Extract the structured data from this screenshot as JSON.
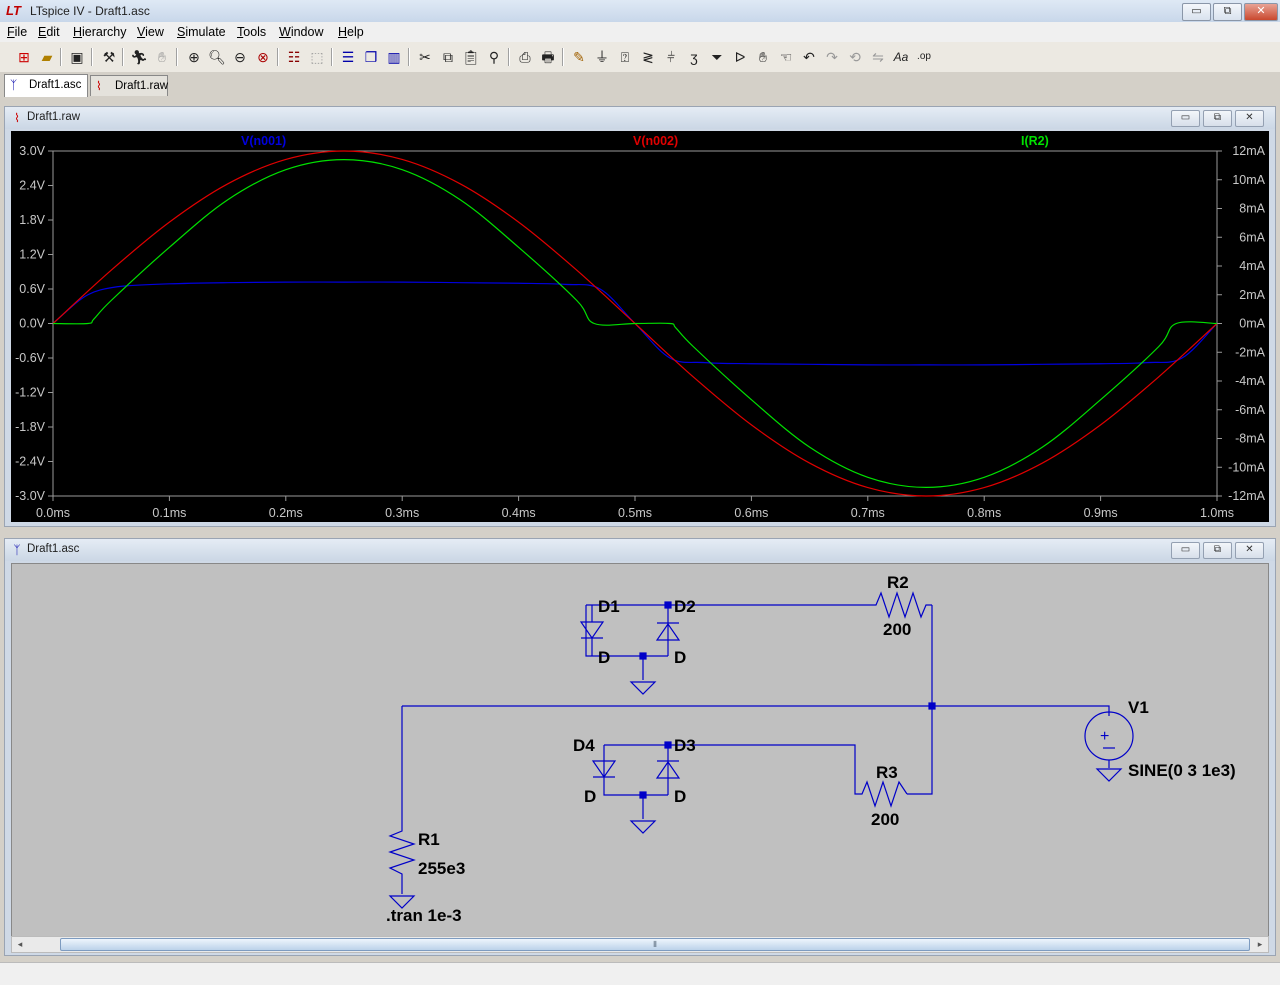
{
  "app": {
    "title": "LTspice IV - Draft1.asc",
    "logo": "LT"
  },
  "window_controls": {
    "minimize": "▭",
    "maximize": "⧉",
    "close": "✕"
  },
  "menu": [
    {
      "label": "File",
      "u": "F",
      "rest": "ile"
    },
    {
      "label": "Edit",
      "u": "E",
      "rest": "dit"
    },
    {
      "label": "Hierarchy",
      "u": "H",
      "rest": "ierarchy"
    },
    {
      "label": "View",
      "u": "V",
      "rest": "iew"
    },
    {
      "label": "Simulate",
      "u": "S",
      "rest": "imulate"
    },
    {
      "label": "Tools",
      "u": "T",
      "rest": "ools"
    },
    {
      "label": "Window",
      "u": "W",
      "rest": "indow"
    },
    {
      "label": "Help",
      "u": "H",
      "rest": "elp"
    }
  ],
  "toolbar_icons": [
    "new-schematic-icon",
    "open-icon",
    "save-icon",
    "control-panel-icon",
    "run-icon",
    "halt-icon",
    "zoom-in-icon",
    "zoom-area-icon",
    "zoom-out-icon",
    "zoom-cancel-icon",
    "autorange-icon",
    "fit-icon",
    "tile-horizontal-icon",
    "cascade-icon",
    "tile-vertical-icon",
    "cut-icon",
    "copy-icon",
    "paste-icon",
    "find-icon",
    "print-setup-icon",
    "print-icon",
    "wire-icon",
    "ground-icon",
    "label-icon",
    "resistor-icon",
    "capacitor-icon",
    "inductor-icon",
    "diode-icon",
    "component-icon",
    "move-icon",
    "drag-icon",
    "undo-icon",
    "redo-icon",
    "rotate-icon",
    "mirror-icon",
    "text-icon",
    "spice-directive-icon"
  ],
  "tabs": [
    {
      "label": "Draft1.asc",
      "active": true
    },
    {
      "label": "Draft1.raw",
      "active": false
    }
  ],
  "plot_window": {
    "title": "Draft1.raw"
  },
  "schematic_window": {
    "title": "Draft1.asc"
  },
  "chart_data": {
    "type": "line",
    "xlabel": "",
    "ylabel": "",
    "xlim": [
      0,
      1.0
    ],
    "ylim_left": [
      -3.0,
      3.0
    ],
    "ylim_right": [
      -12,
      12
    ],
    "x_ticks": [
      "0.0ms",
      "0.1ms",
      "0.2ms",
      "0.3ms",
      "0.4ms",
      "0.5ms",
      "0.6ms",
      "0.7ms",
      "0.8ms",
      "0.9ms",
      "1.0ms"
    ],
    "y_ticks_left": [
      "3.0V",
      "2.4V",
      "1.8V",
      "1.2V",
      "0.6V",
      "0.0V",
      "-0.6V",
      "-1.2V",
      "-1.8V",
      "-2.4V",
      "-3.0V"
    ],
    "y_ticks_right": [
      "12mA",
      "10mA",
      "8mA",
      "6mA",
      "4mA",
      "2mA",
      "0mA",
      "-2mA",
      "-4mA",
      "-6mA",
      "-8mA",
      "-10mA",
      "-12mA"
    ],
    "grid": false,
    "background": "#000000",
    "series": [
      {
        "name": "V(n001)",
        "color": "#0000e0",
        "axis": "left",
        "x": [
          0,
          0.02,
          0.03,
          0.04,
          0.06,
          0.1,
          0.15,
          0.2,
          0.25,
          0.3,
          0.35,
          0.4,
          0.44,
          0.47,
          0.5,
          0.53,
          0.56,
          0.6,
          0.65,
          0.7,
          0.75,
          0.8,
          0.85,
          0.9,
          0.94,
          0.97,
          1.0
        ],
        "y": [
          0,
          0.36,
          0.5,
          0.58,
          0.65,
          0.69,
          0.71,
          0.72,
          0.72,
          0.72,
          0.71,
          0.7,
          0.68,
          0.6,
          0,
          -0.6,
          -0.68,
          -0.7,
          -0.71,
          -0.72,
          -0.72,
          -0.72,
          -0.71,
          -0.7,
          -0.68,
          -0.6,
          0
        ]
      },
      {
        "name": "V(n002)",
        "color": "#e00000",
        "axis": "left",
        "x": [
          0,
          0.05,
          0.1,
          0.15,
          0.2,
          0.25,
          0.3,
          0.35,
          0.4,
          0.45,
          0.5,
          0.55,
          0.6,
          0.65,
          0.7,
          0.75,
          0.8,
          0.85,
          0.9,
          0.95,
          1.0
        ],
        "y": [
          0,
          0.927,
          1.763,
          2.427,
          2.853,
          3.0,
          2.853,
          2.427,
          1.763,
          0.927,
          0,
          -0.927,
          -1.763,
          -2.427,
          -2.853,
          -3.0,
          -2.853,
          -2.427,
          -1.763,
          -0.927,
          0
        ]
      },
      {
        "name": "I(R2)",
        "color": "#00e000",
        "axis": "right",
        "x": [
          0,
          0.03,
          0.035,
          0.05,
          0.1,
          0.15,
          0.2,
          0.25,
          0.3,
          0.35,
          0.4,
          0.45,
          0.465,
          0.5,
          0.53,
          0.535,
          0.55,
          0.6,
          0.65,
          0.7,
          0.75,
          0.8,
          0.85,
          0.9,
          0.95,
          0.965,
          1.0
        ],
        "y": [
          0,
          0,
          0.3,
          1.6,
          5.3,
          8.6,
          10.7,
          11.4,
          10.7,
          8.6,
          5.3,
          1.6,
          0,
          0,
          0,
          -0.3,
          -1.6,
          -5.3,
          -8.6,
          -10.7,
          -11.4,
          -10.7,
          -8.6,
          -5.3,
          -1.6,
          0,
          0
        ]
      }
    ]
  },
  "schematic": {
    "labels": {
      "d1": "D1",
      "d2": "D2",
      "d3": "D3",
      "d4": "D4",
      "d_model_1": "D",
      "d_model_2": "D",
      "d_model_3": "D",
      "d_model_4": "D",
      "r1": "R1",
      "r1_value": "255e3",
      "r2": "R2",
      "r2_value": "200",
      "r3": "R3",
      "r3_value": "200",
      "v1": "V1",
      "v1_value": "SINE(0 3 1e3)",
      "directive": ".tran 1e-3"
    },
    "wire_color": "#0000c8"
  }
}
